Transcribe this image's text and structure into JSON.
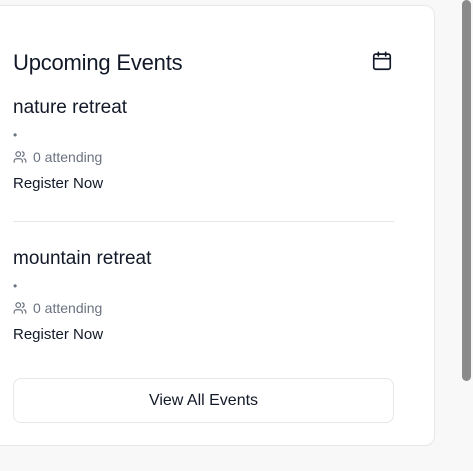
{
  "widget": {
    "title": "Upcoming Events",
    "header_icon": "calendar-icon",
    "view_all_label": "View All Events"
  },
  "events": [
    {
      "title": "nature retreat",
      "dot": "•",
      "attending_text": "0 attending",
      "attending_icon": "users-icon",
      "register_label": "Register Now"
    },
    {
      "title": "mountain retreat",
      "dot": "•",
      "attending_text": "0 attending",
      "attending_icon": "users-icon",
      "register_label": "Register Now"
    }
  ],
  "colors": {
    "text_primary": "#111827",
    "text_muted": "#6b7280",
    "border": "#e5e7eb",
    "card_bg": "#ffffff",
    "page_bg": "#f8f8f9",
    "scrollbar": "#8a8a8a"
  }
}
